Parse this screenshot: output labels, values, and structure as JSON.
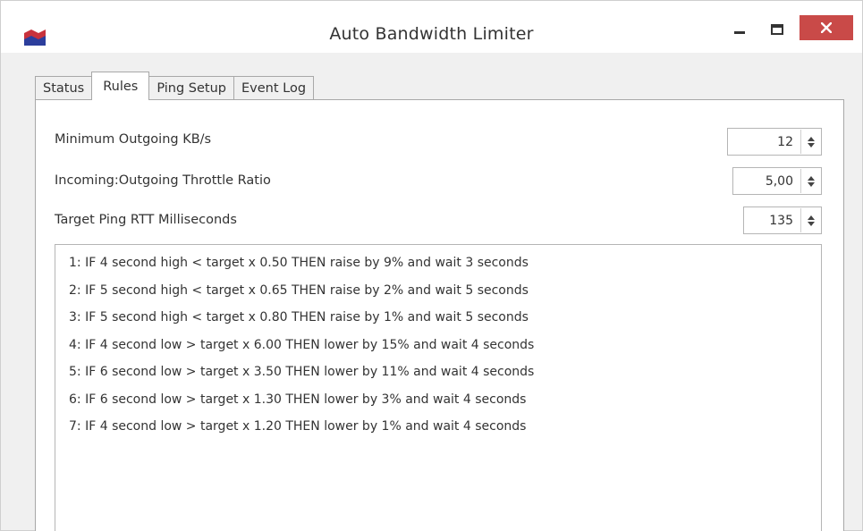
{
  "window": {
    "title": "Auto Bandwidth Limiter",
    "colors": {
      "close_button": "#c94a48",
      "icon_red": "#c8323c",
      "icon_blue": "#2c3e9c"
    }
  },
  "tabs": [
    {
      "label": "Status",
      "active": false
    },
    {
      "label": "Rules",
      "active": true
    },
    {
      "label": "Ping Setup",
      "active": false
    },
    {
      "label": "Event Log",
      "active": false
    }
  ],
  "settings": {
    "min_outgoing": {
      "label": "Minimum Outgoing KB/s",
      "value": "12"
    },
    "throttle_ratio": {
      "label": "Incoming:Outgoing Throttle Ratio",
      "value": "5,00"
    },
    "target_ping": {
      "label": "Target Ping RTT Milliseconds",
      "value": "135"
    }
  },
  "rules": [
    "1:  IF 4 second high < target x 0.50 THEN raise by 9% and wait 3 seconds",
    "2:  IF 5 second high < target x 0.65 THEN raise by 2% and wait 5 seconds",
    "3:  IF 5 second high < target x 0.80 THEN raise by 1% and wait 5 seconds",
    "4:  IF 4 second low > target x 6.00 THEN lower by 15% and wait 4 seconds",
    "5:  IF 6 second low > target x 3.50 THEN lower by 11% and wait 4 seconds",
    "6:  IF 6 second low > target x 1.30 THEN lower by 3% and wait 4 seconds",
    "7:  IF 4 second low > target x 1.20 THEN lower by 1% and wait 4 seconds"
  ]
}
